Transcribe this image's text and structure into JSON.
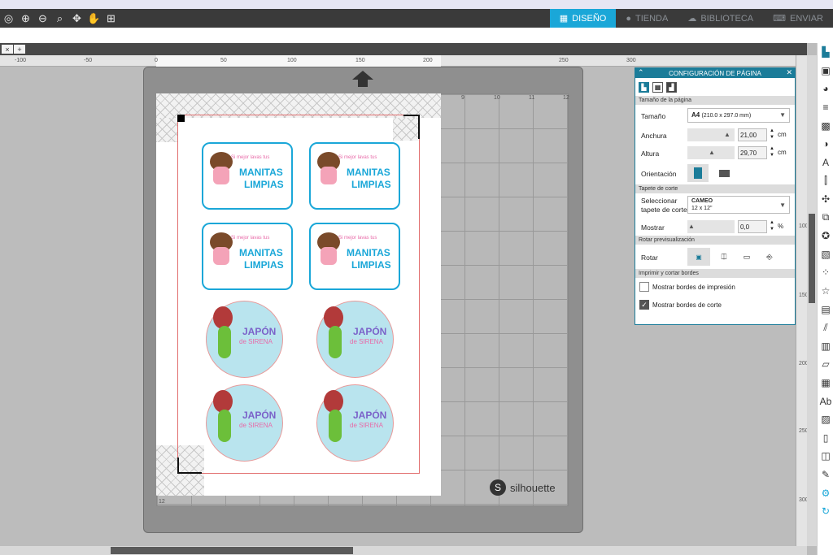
{
  "toolbar": {
    "icons": [
      "zoom-in-icon",
      "zoom-out-icon",
      "zoom-select-icon",
      "move-down-icon",
      "hand-icon",
      "fit-page-icon"
    ]
  },
  "nav_tabs": [
    {
      "label": "DISEÑO",
      "icon": "grid-icon",
      "active": true
    },
    {
      "label": "TIENDA",
      "icon": "silhouette-s-icon",
      "active": false
    },
    {
      "label": "BIBLIOTECA",
      "icon": "cloud-icon",
      "active": false
    },
    {
      "label": "ENVIAR",
      "icon": "send-icon",
      "active": false
    }
  ],
  "doc_tabs": {
    "close": "×",
    "add": "+"
  },
  "ruler": {
    "h_labels": [
      "-100",
      "-50",
      "0",
      "50",
      "100",
      "150",
      "200",
      "250",
      "300",
      "350"
    ],
    "v_labels": [
      "100",
      "150",
      "200",
      "250",
      "300"
    ]
  },
  "mat": {
    "brand": "silhouette",
    "grid_numbers": [
      "9",
      "10",
      "11",
      "12",
      "12"
    ]
  },
  "stickers": {
    "manitas": {
      "line1": "Si mejor lavas tus",
      "line2": "MANITAS",
      "line3": "LIMPIAS"
    },
    "sirena": {
      "line1": "JAPÓN",
      "line2": "de SIRENA"
    }
  },
  "panel": {
    "title": "CONFIGURACIÓN DE PÁGINA",
    "sec_page": "Tamaño de la página",
    "size_label": "Tamaño",
    "size_value": "A4",
    "size_dims": "(210.0 x 297.0 mm)",
    "width_label": "Anchura",
    "width_value": "21,00",
    "width_unit": "cm",
    "height_label": "Altura",
    "height_value": "29,70",
    "height_unit": "cm",
    "orientation_label": "Orientación",
    "sec_mat": "Tapete de corte",
    "mat_label_1": "Seleccionar",
    "mat_label_2": "tapete de corte",
    "mat_value": "CAMEO",
    "mat_size": "12 x 12\"",
    "show_label": "Mostrar",
    "show_value": "0,0",
    "show_unit": "%",
    "sec_rotate": "Rotar previsualización",
    "rotate_label": "Rotar",
    "sec_borders": "Imprimir y cortar bordes",
    "print_borders_label": "Mostrar bordes de impresión",
    "print_borders_checked": false,
    "cut_borders_label": "Mostrar bordes de corte",
    "cut_borders_checked": true
  },
  "colors": {
    "accent": "#1aa7d8",
    "panel_header": "#1b7c99",
    "cut_line": "#e27070"
  }
}
